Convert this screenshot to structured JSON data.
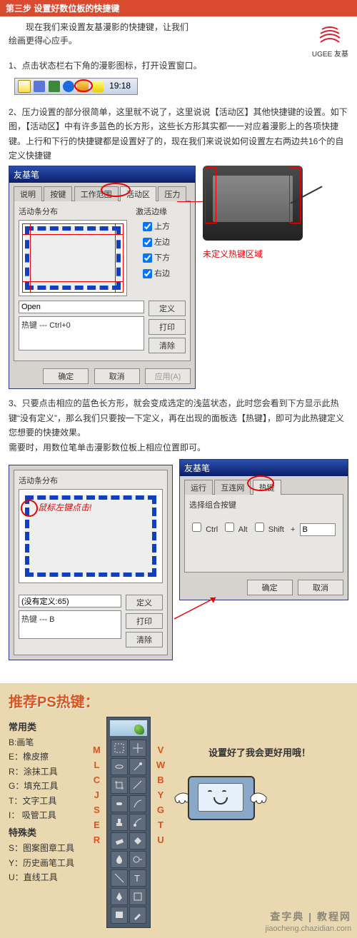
{
  "header": {
    "step_title": "第三步 设置好数位板的快捷键"
  },
  "intro": {
    "line1": "现在我们来设置友基漫影的快捷键，让我们",
    "line2": "绘画更得心应手。"
  },
  "brand": {
    "name": "UGEE 友基"
  },
  "point1": {
    "text": "1、点击状态栏右下角的漫影图标，打开设置窗口。",
    "tray_time": "19:18"
  },
  "point2": {
    "text": "2、压力设置的部分很简单，这里就不说了，这里说说【活动区】其他快捷键的设置。如下图，【活动区】中有许多蓝色的长方形，这些长方形其实都一一对应着漫影上的各项快捷键。上行和下行的快捷键都是设置好了的，现在我们来说说如何设置左右两边共16个的自定义快捷键",
    "dialog": {
      "title": "友基笔",
      "tabs": [
        "说明",
        "按键",
        "工作范围",
        "活动区",
        "压力"
      ],
      "active_tab_index": 3,
      "group_left": "活动条分布",
      "group_right": "激活边缘",
      "edges": {
        "top": "上方",
        "left": "左边",
        "bottom": "下方",
        "right": "右边"
      },
      "open_value": "Open",
      "hotkey_value": "热键 --- Ctrl+0",
      "btn_define": "定义",
      "btn_print": "打印",
      "btn_clear": "清除",
      "btn_ok": "确定",
      "btn_cancel": "取消",
      "btn_apply": "应用(A)"
    },
    "callout": "未定义热键区域"
  },
  "point3": {
    "text": "3、只要点击相应的蓝色长方形，就会变成选定的浅蓝状态，此时您会看到下方显示此热键“没有定义”，那么我们只要按一下定义，再在出现的面板选【热键】，即可为此热键定义您想要的快捷效果。\n需要时，用数位笔单击漫影数位板上相应位置即可。",
    "left_dialog": {
      "group": "活动条分布",
      "callout": "鼠标左键点击!",
      "no_def_value": "(没有定义:65)",
      "hotkey_value": "热键 --- B",
      "btn_define": "定义",
      "btn_print": "打印",
      "btn_clear": "清除"
    },
    "right_dialog": {
      "title": "友基笔",
      "tabs": [
        "运行",
        "互连网",
        "热键"
      ],
      "active_tab_index": 2,
      "group": "选择组合按键",
      "ctrl": "Ctrl",
      "alt": "Alt",
      "shift": "Shift",
      "plus": "+",
      "key_value": "B",
      "btn_ok": "确定",
      "btn_cancel": "取消"
    }
  },
  "rec": {
    "title": "推荐PS热键：",
    "common_head": "常用类",
    "common": [
      {
        "k": "B",
        "label": "画笔"
      },
      {
        "k": "E",
        "label": "橡皮擦"
      },
      {
        "k": "R",
        "label": "涂抹工具"
      },
      {
        "k": "G",
        "label": "填充工具"
      },
      {
        "k": "T",
        "label": "文字工具"
      },
      {
        "k": "I",
        "label": "吸管工具"
      }
    ],
    "special_head": "特殊类",
    "special": [
      {
        "k": "S",
        "label": "图案图章工具"
      },
      {
        "k": "Y",
        "label": "历史画笔工具"
      },
      {
        "k": "U",
        "label": "直线工具"
      }
    ],
    "left_letters": [
      "M",
      "L",
      "C",
      "J",
      "S",
      "E",
      "R"
    ],
    "right_letters": [
      "V",
      "W",
      "B",
      "Y",
      "G",
      "T",
      "U"
    ],
    "speech": "设置好了我会更好用哦！"
  },
  "watermark": {
    "line1": "查字典 | 教程网",
    "line2": "jiaocheng.chazidian.com"
  }
}
